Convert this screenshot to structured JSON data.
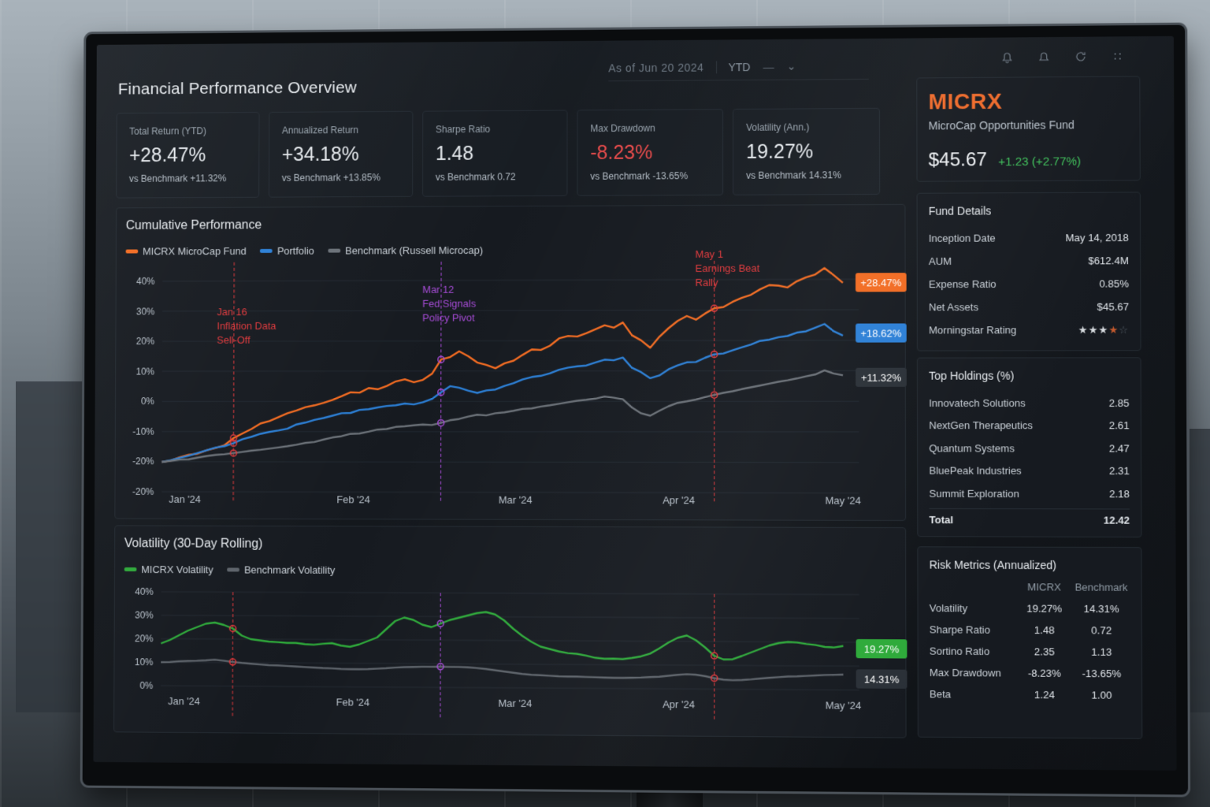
{
  "dashboard": {
    "title": "Financial Performance Overview",
    "date_range": "As of Jun 20 2024",
    "period": "YTD",
    "dash": "—"
  },
  "icons": [
    "bell-icon",
    "notification-icon",
    "refresh-icon",
    "expand-icon"
  ],
  "kpis": [
    {
      "label": "Total Return (YTD)",
      "value": "+28.47%",
      "sub": "vs Benchmark +11.32%"
    },
    {
      "label": "Annualized Return",
      "value": "+34.18%",
      "sub": "vs Benchmark +13.85%"
    },
    {
      "label": "Sharpe Ratio",
      "value": "1.48",
      "sub": "vs Benchmark 0.72"
    },
    {
      "label": "Max Drawdown",
      "value": "-8.23%",
      "sub": "vs Benchmark -13.65%"
    },
    {
      "label": "Volatility (Ann.)",
      "value": "19.27%",
      "sub": "vs Benchmark 14.31%"
    }
  ],
  "fund": {
    "ticker": "MICRX",
    "name": "MicroCap Opportunities Fund",
    "price": "$45.67",
    "change": "+1.23 (+2.77%)"
  },
  "fund_details": {
    "title": "Fund Details",
    "rows": [
      {
        "k": "Inception Date",
        "v": "May 14, 2018"
      },
      {
        "k": "AUM",
        "v": "$612.4M"
      },
      {
        "k": "Expense Ratio",
        "v": "0.85%"
      },
      {
        "k": "Net Assets",
        "v": "$45.67"
      }
    ],
    "rating_label": "Morningstar Rating",
    "rating": 3.5
  },
  "holdings": {
    "title": "Top Holdings (%)",
    "rows": [
      {
        "k": "Innovatech Solutions",
        "v": "2.85"
      },
      {
        "k": "NextGen Therapeutics",
        "v": "2.61"
      },
      {
        "k": "Quantum Systems",
        "v": "2.47"
      },
      {
        "k": "BluePeak Industries",
        "v": "2.31"
      },
      {
        "k": "Summit Exploration",
        "v": "2.18"
      }
    ],
    "total_label": "Total",
    "total": "12.42"
  },
  "risk": {
    "title": "Risk Metrics (Annualized)",
    "col1": "MICRX",
    "col2": "Benchmark",
    "rows": [
      {
        "k": "Volatility",
        "a": "19.27%",
        "b": "14.31%"
      },
      {
        "k": "Sharpe Ratio",
        "a": "1.48",
        "b": "0.72"
      },
      {
        "k": "Sortino Ratio",
        "a": "2.35",
        "b": "1.13"
      },
      {
        "k": "Max Drawdown",
        "a": "-8.23%",
        "b": "-13.65%"
      },
      {
        "k": "Beta",
        "a": "1.24",
        "b": "1.00"
      }
    ]
  },
  "colors": {
    "fund": "#f26b21",
    "portfolio": "#2b7fd6",
    "benchmark": "#6b7178",
    "vol_fund": "#2eaa3a",
    "vol_bench": "#5d636a",
    "annotation_red": "#e0383b",
    "annotation_purple": "#a64bd6"
  },
  "chart_data": [
    {
      "type": "line",
      "title": "Cumulative Performance",
      "xticks": [
        "Jan '24",
        "Feb '24",
        "Mar '24",
        "Apr '24",
        "May '24"
      ],
      "ylim": [
        -20,
        40
      ],
      "yticks": [
        "40%",
        "30%",
        "20%",
        "10%",
        "0%",
        "-10%",
        "-20%",
        "-20%"
      ],
      "series": [
        {
          "name": "MICRX MicroCap Fund",
          "color": "#f26b21",
          "end_label": "+28.47%",
          "values": [
            -20,
            -19.5,
            -18.4,
            -17.6,
            -17.2,
            -16.1,
            -15.3,
            -14.4,
            -12.0,
            -10.5,
            -9.0,
            -7.2,
            -6.4,
            -5.1,
            -3.8,
            -2.9,
            -1.8,
            -1.2,
            -0.4,
            0.6,
            1.8,
            3.1,
            3.0,
            4.5,
            4.1,
            5.2,
            6.7,
            7.4,
            6.4,
            7.2,
            9.2,
            13.9,
            14.7,
            16.6,
            15.0,
            12.9,
            12.1,
            11.0,
            12.6,
            13.5,
            15.4,
            17.2,
            17.0,
            18.4,
            20.8,
            21.6,
            21.4,
            22.5,
            23.8,
            25.1,
            24.3,
            26.0,
            21.8,
            20.1,
            17.7,
            21.3,
            24.1,
            26.5,
            28.1,
            26.9,
            28.9,
            30.6,
            31.0,
            32.7,
            34.0,
            35.0,
            36.8,
            38.2,
            38.0,
            37.4,
            39.4,
            40.7,
            41.6,
            43.7,
            41.4,
            38.9
          ]
        },
        {
          "name": "Portfolio",
          "color": "#2b7fd6",
          "end_label": "+18.62%",
          "values": [
            -20,
            -19.4,
            -18.6,
            -17.9,
            -17.0,
            -16.1,
            -15.2,
            -14.7,
            -13.7,
            -12.4,
            -11.6,
            -10.6,
            -10.0,
            -9.5,
            -8.9,
            -7.5,
            -6.9,
            -6.0,
            -5.4,
            -4.6,
            -3.8,
            -3.7,
            -2.7,
            -2.5,
            -1.9,
            -1.4,
            -1.2,
            -0.6,
            -0.9,
            -0.2,
            0.9,
            3.1,
            5.1,
            4.6,
            3.6,
            2.9,
            3.7,
            4.0,
            5.2,
            6.1,
            7.3,
            8.1,
            8.5,
            9.3,
            10.5,
            11.2,
            11.6,
            11.9,
            12.9,
            13.8,
            13.6,
            14.5,
            11.1,
            9.7,
            7.7,
            8.6,
            10.6,
            11.9,
            12.9,
            13.0,
            14.4,
            15.5,
            15.8,
            16.8,
            17.8,
            18.7,
            19.9,
            20.3,
            21.1,
            21.5,
            22.6,
            23.0,
            24.2,
            25.4,
            23.0,
            21.6
          ]
        },
        {
          "name": "Benchmark (Russell Microcap)",
          "color": "#6b7178",
          "end_label": "+11.32%",
          "values": [
            -20,
            -19.6,
            -19.2,
            -19.1,
            -18.5,
            -18.0,
            -17.6,
            -17.4,
            -17.0,
            -16.6,
            -16.2,
            -15.9,
            -15.5,
            -15.1,
            -14.7,
            -14.2,
            -13.6,
            -13.3,
            -12.5,
            -11.8,
            -11.4,
            -10.6,
            -10.5,
            -9.9,
            -9.2,
            -9.0,
            -8.3,
            -8.1,
            -7.8,
            -7.5,
            -7.7,
            -7.0,
            -6.1,
            -5.7,
            -4.9,
            -4.3,
            -4.5,
            -3.8,
            -3.5,
            -3.0,
            -2.4,
            -2.2,
            -1.6,
            -1.2,
            -0.7,
            -0.2,
            0.3,
            0.6,
            1.0,
            1.7,
            1.3,
            0.8,
            -1.9,
            -3.8,
            -4.6,
            -3.0,
            -1.5,
            -0.4,
            0.1,
            0.7,
            1.5,
            2.2,
            2.9,
            3.4,
            4.1,
            4.7,
            5.3,
            5.9,
            6.5,
            7.0,
            7.6,
            8.3,
            8.9,
            10.2,
            9.2,
            8.6
          ]
        }
      ],
      "annotations": [
        {
          "date": "Jan 16",
          "text": [
            "Jan 16",
            "Inflation Data",
            "Sell-Off"
          ],
          "color": "#e0383b"
        },
        {
          "date": "Mar 12",
          "text": [
            "Mar 12",
            "Fed Signals",
            "Policy Pivot"
          ],
          "color": "#a64bd6"
        },
        {
          "date": "May 1",
          "text": [
            "May 1",
            "Earnings Beat",
            "Rally"
          ],
          "color": "#e0383b"
        }
      ]
    },
    {
      "type": "line",
      "title": "Volatility (30-Day Rolling)",
      "xticks": [
        "Jan '24",
        "Feb '24",
        "Mar '24",
        "Apr '24",
        "May '24"
      ],
      "ylim": [
        0,
        40
      ],
      "yticks": [
        "40%",
        "30%",
        "20%",
        "10%",
        "0%"
      ],
      "series": [
        {
          "name": "MICRX Volatility",
          "color": "#2eaa3a",
          "end_label": "19.27%",
          "values": [
            18.0,
            19.5,
            21.5,
            23.5,
            25.0,
            26.5,
            27.0,
            26.0,
            24.5,
            21.5,
            20.0,
            19.5,
            19.0,
            18.8,
            18.5,
            18.5,
            18.0,
            17.8,
            18.2,
            18.5,
            17.5,
            17.0,
            18.0,
            19.5,
            21.0,
            24.5,
            28.0,
            29.5,
            28.5,
            26.5,
            25.5,
            27.0,
            28.5,
            29.5,
            30.5,
            31.5,
            32.0,
            31.0,
            28.5,
            25.0,
            22.0,
            19.5,
            17.5,
            16.5,
            15.5,
            14.8,
            14.5,
            13.8,
            12.9,
            12.5,
            12.6,
            12.4,
            12.9,
            13.6,
            14.8,
            17.0,
            19.5,
            21.5,
            22.5,
            20.5,
            17.5,
            14.0,
            12.5,
            12.6,
            14.0,
            15.5,
            17.0,
            18.5,
            19.5,
            20.0,
            19.8,
            19.2,
            18.8,
            18.0,
            17.8,
            18.4
          ]
        },
        {
          "name": "Benchmark Volatility",
          "color": "#5d636a",
          "end_label": "14.31%",
          "values": [
            10.0,
            10.1,
            10.4,
            10.6,
            10.7,
            10.9,
            11.2,
            10.8,
            10.3,
            9.9,
            9.6,
            9.3,
            9.0,
            8.9,
            8.7,
            8.5,
            8.3,
            8.1,
            7.9,
            7.8,
            7.6,
            7.5,
            7.5,
            7.6,
            7.8,
            8.0,
            8.3,
            8.5,
            8.6,
            8.7,
            8.7,
            8.8,
            8.7,
            8.7,
            8.6,
            8.3,
            7.9,
            7.4,
            6.9,
            6.4,
            5.9,
            5.6,
            5.4,
            5.2,
            5.0,
            4.9,
            4.9,
            4.8,
            4.7,
            4.6,
            4.5,
            4.5,
            4.6,
            4.7,
            4.9,
            5.1,
            5.5,
            5.9,
            6.2,
            6.0,
            5.4,
            4.6,
            4.0,
            3.8,
            3.9,
            4.2,
            4.6,
            4.9,
            5.2,
            5.5,
            5.6,
            5.8,
            6.0,
            6.2,
            6.3,
            6.4
          ]
        }
      ]
    }
  ]
}
